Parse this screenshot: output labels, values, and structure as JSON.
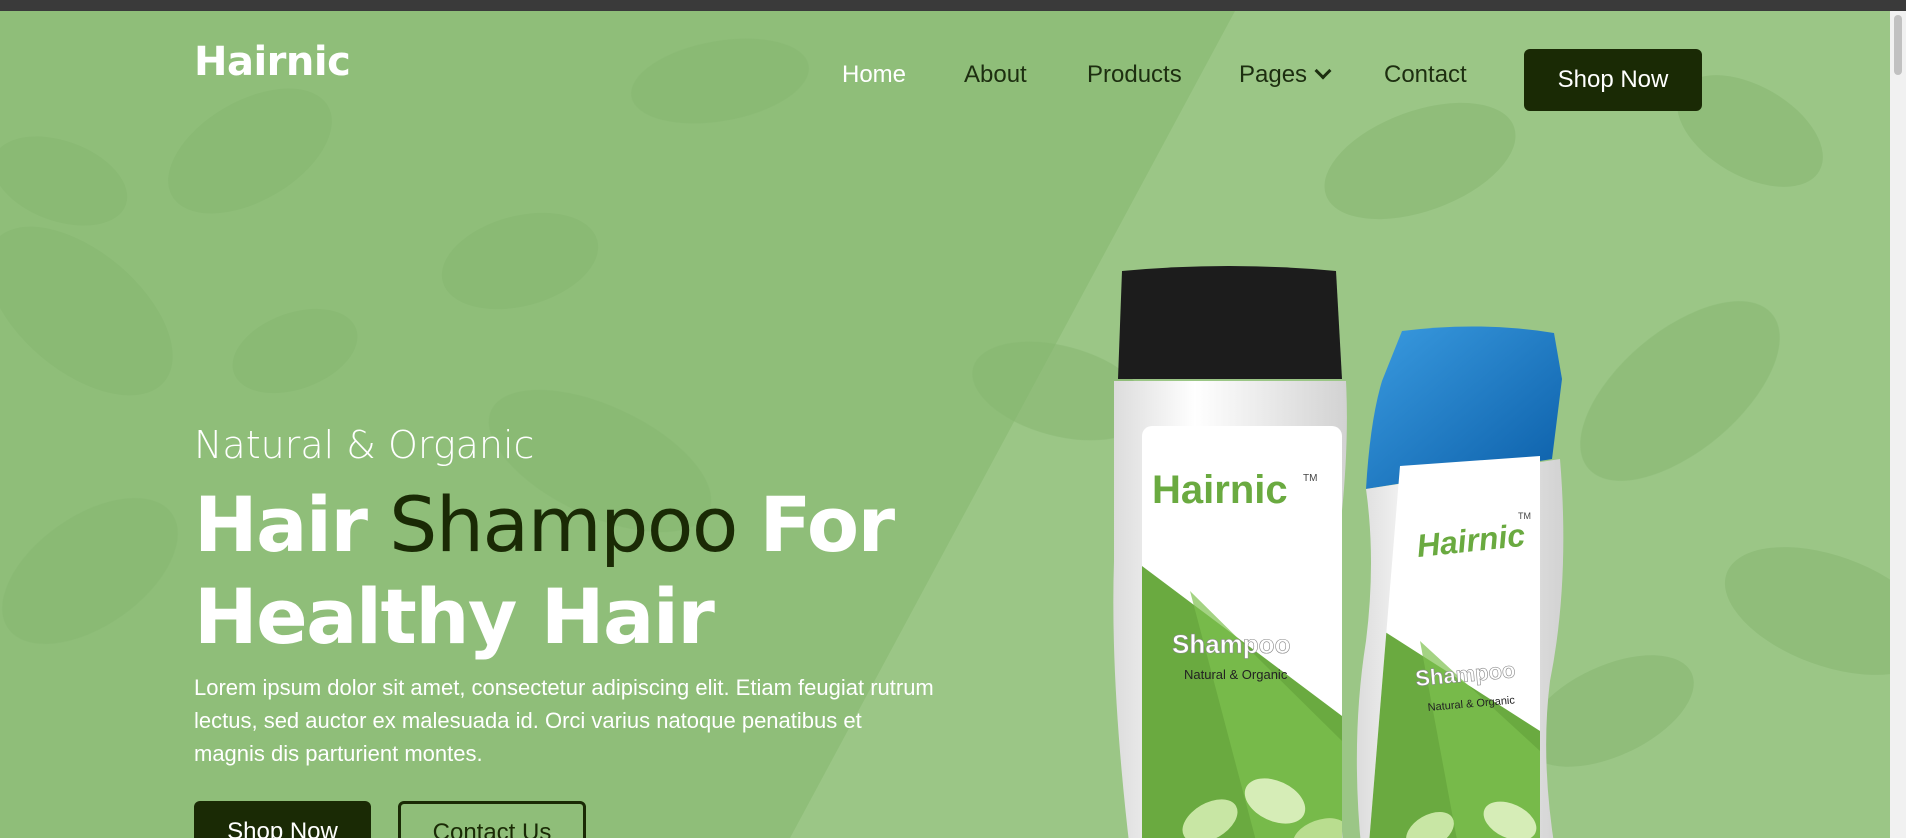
{
  "brand": {
    "name": "Hairnic"
  },
  "nav": {
    "items": [
      {
        "label": "Home",
        "active": true
      },
      {
        "label": "About"
      },
      {
        "label": "Products"
      },
      {
        "label": "Pages",
        "has_dropdown": true
      },
      {
        "label": "Contact"
      }
    ],
    "cta_label": "Shop Now"
  },
  "hero": {
    "subtitle": "Natural & Organic",
    "title_part1": "Hair",
    "title_part2": "Shampoo",
    "title_part3": "For",
    "title_line2": "Healthy Hair",
    "description": "Lorem ipsum dolor sit amet, consectetur adipiscing elit. Etiam feugiat rutrum lectus, sed auctor ex malesuada id. Orci varius natoque penatibus et magnis dis parturient montes.",
    "primary_button": "Shop Now",
    "secondary_button": "Contact Us"
  },
  "product": {
    "brand_label": "Hairnic",
    "trademark": "TM",
    "type_label": "Shampoo",
    "tagline": "Natural & Organic"
  },
  "colors": {
    "background": "#8fbe79",
    "dark": "#1a2a05",
    "text_light": "#ffffff"
  }
}
